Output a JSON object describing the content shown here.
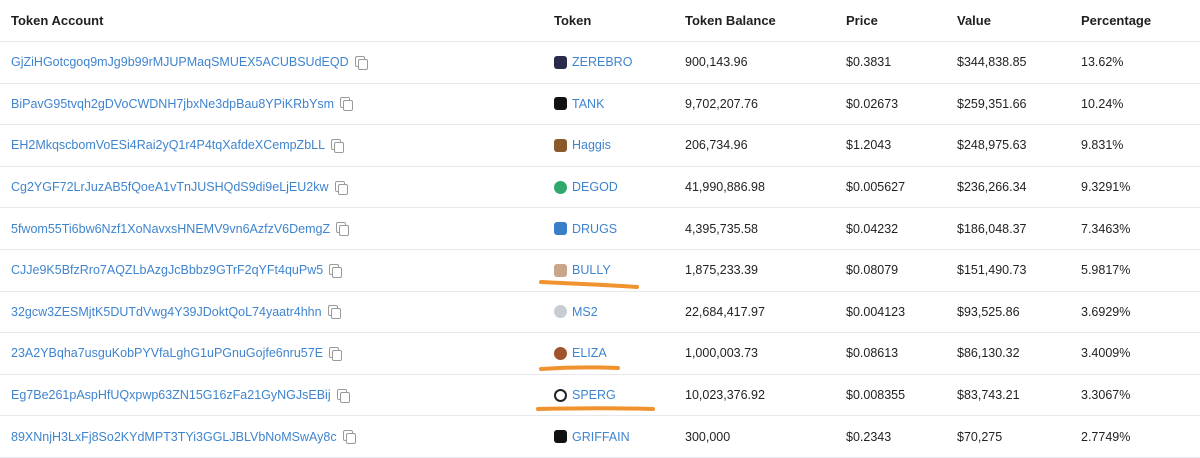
{
  "columns": {
    "account": "Token Account",
    "token": "Token",
    "balance": "Token Balance",
    "price": "Price",
    "value": "Value",
    "percentage": "Percentage"
  },
  "rows": [
    {
      "account": "GjZiHGotcgoq9mJg9b99rMJUPMaqSMUEX5ACUBSUdEQD",
      "token": "ZEREBRO",
      "icon": "zerebro-icon",
      "icon_color": "#2a2a4a",
      "balance": "900,143.96",
      "price": "$0.3831",
      "value": "$344,838.85",
      "percentage": "13.62%"
    },
    {
      "account": "BiPavG95tvqh2gDVoCWDNH7jbxNe3dpBau8YPiKRbYsm",
      "token": "TANK",
      "icon": "tank-icon",
      "icon_color": "#111111",
      "balance": "9,702,207.76",
      "price": "$0.02673",
      "value": "$259,351.66",
      "percentage": "10.24%"
    },
    {
      "account": "EH2MkqscbomVoESi4Rai2yQ1r4P4tqXafdeXCempZbLL",
      "token": "Haggis",
      "icon": "haggis-icon",
      "icon_color": "#8a5a2b",
      "balance": "206,734.96",
      "price": "$1.2043",
      "value": "$248,975.63",
      "percentage": "9.831%"
    },
    {
      "account": "Cg2YGF72LrJuzAB5fQoeA1vTnJUSHQdS9di9eLjEU2kw",
      "token": "DEGOD",
      "icon": "degod-icon",
      "icon_color": "#2fa86b",
      "balance": "41,990,886.98",
      "price": "$0.005627",
      "value": "$236,266.34",
      "percentage": "9.3291%"
    },
    {
      "account": "5fwom55Ti6bw6Nzf1XoNavxsHNEMV9vn6AzfzV6DemgZ",
      "token": "DRUGS",
      "icon": "drugs-icon",
      "icon_color": "#3a7ec7",
      "balance": "4,395,735.58",
      "price": "$0.04232",
      "value": "$186,048.37",
      "percentage": "7.3463%"
    },
    {
      "account": "CJJe9K5BfzRro7AQZLbAzgJcBbbz9GTrF2qYFt4quPw5",
      "token": "BULLY",
      "icon": "bully-icon",
      "icon_color": "#c9a68a",
      "balance": "1,875,233.39",
      "price": "$0.08079",
      "value": "$151,490.73",
      "percentage": "5.9817%"
    },
    {
      "account": "32gcw3ZESMjtK5DUTdVwg4Y39JDoktQoL74yaatr4hhn",
      "token": "MS2",
      "icon": "ms2-icon",
      "icon_color": "#c8ccd3",
      "balance": "22,684,417.97",
      "price": "$0.004123",
      "value": "$93,525.86",
      "percentage": "3.6929%"
    },
    {
      "account": "23A2YBqha7usguKobPYVfaLghG1uPGnuGojfe6nru57E",
      "token": "ELIZA",
      "icon": "eliza-icon",
      "icon_color": "#a0522d",
      "balance": "1,000,003.73",
      "price": "$0.08613",
      "value": "$86,130.32",
      "percentage": "3.4009%"
    },
    {
      "account": "Eg7Be261pAspHfUQxpwp63ZN15G16zFa21GyNGJsEBij",
      "token": "SPERG",
      "icon": "sperg-icon",
      "icon_color": "#222222",
      "balance": "10,023,376.92",
      "price": "$0.008355",
      "value": "$83,743.21",
      "percentage": "3.3067%"
    },
    {
      "account": "89XNnjH3LxFj8So2KYdMPT3TYi3GGLJBLVbNoMSwAy8c",
      "token": "GRIFFAIN",
      "icon": "griffain-icon",
      "icon_color": "#111111",
      "balance": "300,000",
      "price": "$0.2343",
      "value": "$70,275",
      "percentage": "2.7749%"
    }
  ],
  "annotation_color": "#f0922e"
}
